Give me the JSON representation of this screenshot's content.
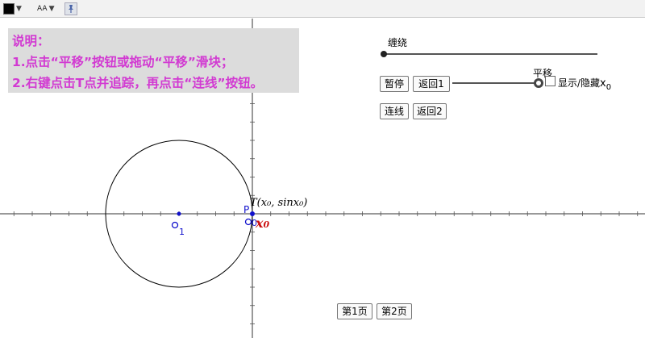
{
  "toolbar": {
    "style_icon": "color-swatch-icon",
    "text_size_label": "AA",
    "pin_icon": "pin-icon"
  },
  "note": {
    "title": "说明：",
    "line1": "1.点击“平移”按钮或拖动“平移”滑块；",
    "line2": "2.右键点击T点并追踪，再点击“连线”按钮。",
    "text_color": "#d23ad2",
    "bg_color": "#dcdcdc"
  },
  "controls": {
    "wind_slider_label": "缠绕",
    "wind_value": 0,
    "pause_button": "暂停",
    "return1_button": "返回1",
    "translate_slider_label": "平移",
    "translate_value": 1,
    "show_hide_label": "显示/隐藏",
    "show_hide_var": "x",
    "show_hide_sub": "0",
    "connect_button": "连线",
    "return2_button": "返回2"
  },
  "graph": {
    "point_T_label": "T(x₀, sinx₀)",
    "point_P_label": "P",
    "point_O1_label": "O",
    "point_O1_sub": "1",
    "point_O0_label": "O",
    "point_O0_sub": "0",
    "x0_label": "x",
    "x0_sub": "0",
    "point_color": "#1010cc",
    "x0_color": "#cc1010"
  },
  "pages": {
    "page1_button": "第1页",
    "page2_button": "第2页"
  }
}
